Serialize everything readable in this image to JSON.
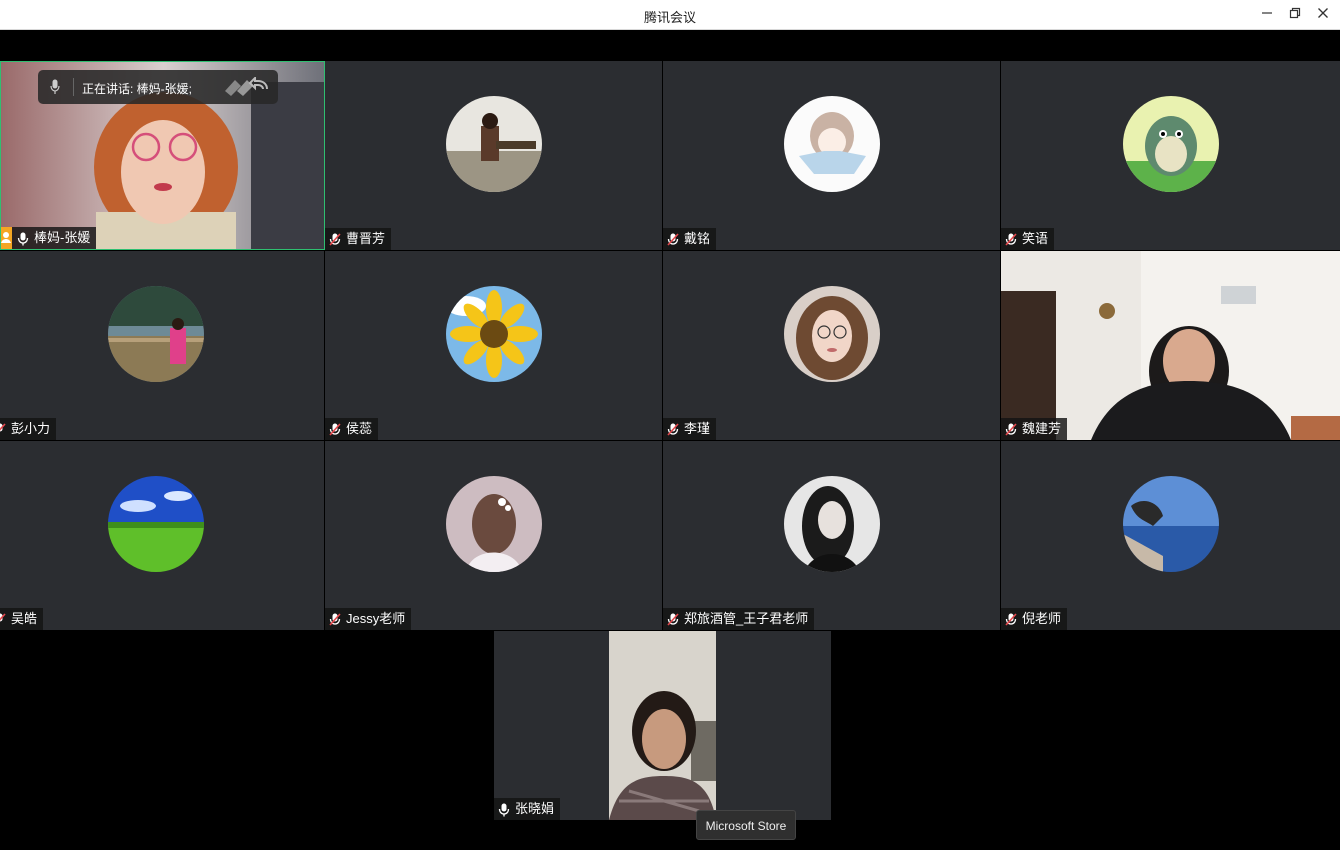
{
  "window": {
    "title": "腾讯会议"
  },
  "speaking_bar": {
    "label": "正在讲话: 棒妈-张媛;"
  },
  "participants": [
    {
      "name": "棒妈-张媛"
    },
    {
      "name": "曹晋芳"
    },
    {
      "name": "戴铭"
    },
    {
      "name": "笑语"
    },
    {
      "name": "彭小力"
    },
    {
      "name": "侯蕊"
    },
    {
      "name": "李瑾"
    },
    {
      "name": "魏建芳"
    },
    {
      "name": "吴皓"
    },
    {
      "name": "Jessy老师"
    },
    {
      "name": "郑旅酒管_王子君老师"
    },
    {
      "name": "倪老师"
    },
    {
      "name": "张晓娟"
    }
  ],
  "tooltip": {
    "label": "Microsoft Store"
  },
  "colors": {
    "active_border": "#2fbf71",
    "tile_bg": "#2b2d31",
    "host_badge": "#f5a623"
  }
}
